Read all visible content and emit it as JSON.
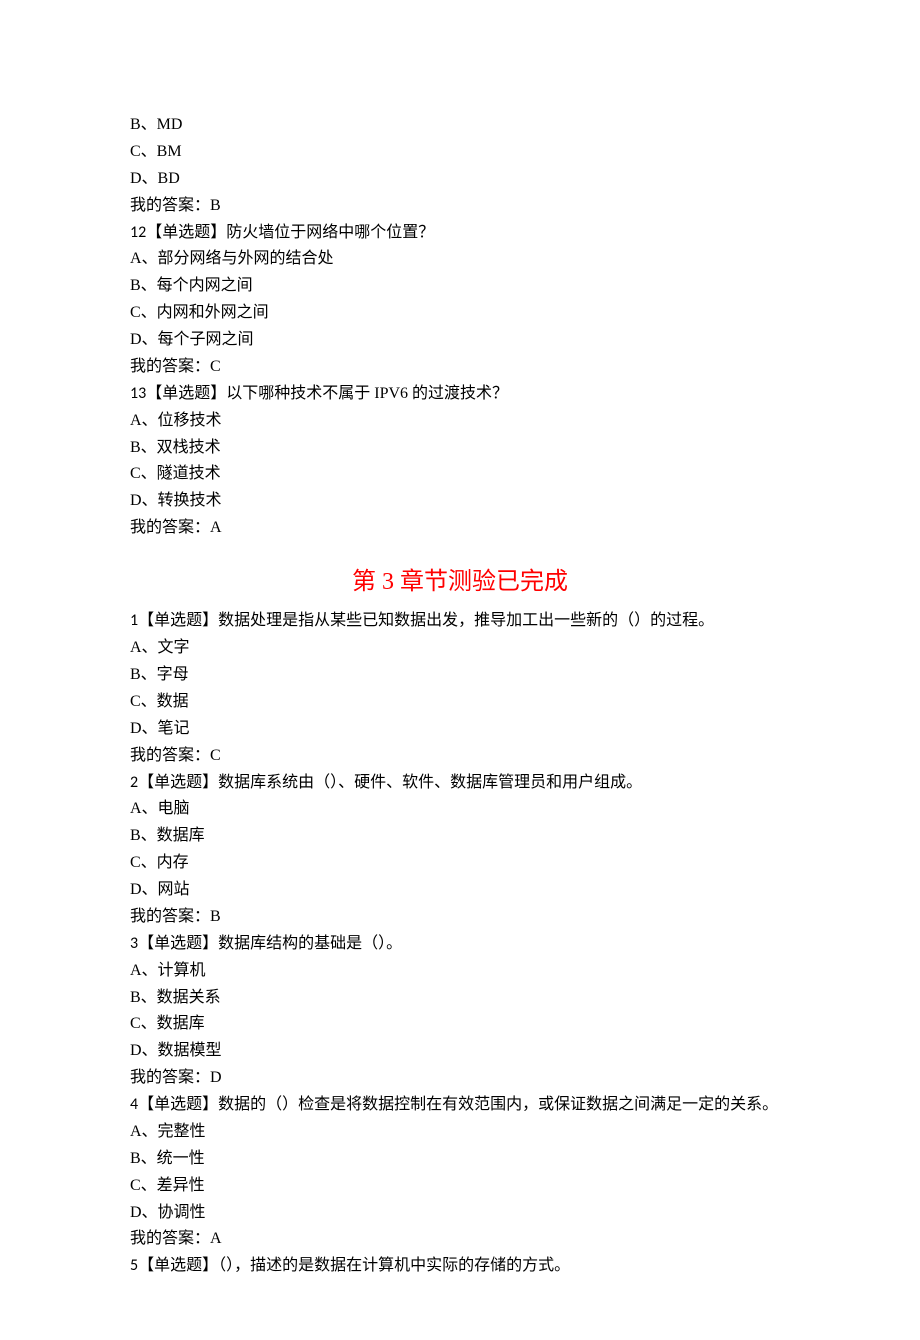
{
  "colors": {
    "heading": "#ff0000",
    "body": "#000000"
  },
  "truncatedOptions": [
    "B、MD",
    "C、BM",
    "D、BD",
    "我的答案：B"
  ],
  "questions_top": [
    {
      "num": "12",
      "tag": "【单选题】",
      "stem": "防火墙位于网络中哪个位置？",
      "options": [
        "A、部分网络与外网的结合处",
        "B、每个内网之间",
        "C、内网和外网之间",
        "D、每个子网之间"
      ],
      "answer": "我的答案：C"
    },
    {
      "num": "13",
      "tag": "【单选题】",
      "stem": "以下哪种技术不属于 IPV6 的过渡技术？",
      "options": [
        "A、位移技术",
        "B、双栈技术",
        "C、隧道技术",
        "D、转换技术"
      ],
      "answer": "我的答案：A"
    }
  ],
  "heading": "第 3 章节测验已完成",
  "questions_bottom": [
    {
      "num": "1",
      "tag": "【单选题】",
      "stem": "数据处理是指从某些已知数据出发，推导加工出一些新的（）的过程。",
      "options": [
        "A、文字",
        "B、字母",
        "C、数据",
        "D、笔记"
      ],
      "answer": "我的答案：C"
    },
    {
      "num": "2",
      "tag": "【单选题】",
      "stem": "数据库系统由（）、硬件、软件、数据库管理员和用户组成。",
      "options": [
        "A、电脑",
        "B、数据库",
        "C、内存",
        "D、网站"
      ],
      "answer": "我的答案：B"
    },
    {
      "num": "3",
      "tag": "【单选题】",
      "stem": "数据库结构的基础是（）。",
      "options": [
        "A、计算机",
        "B、数据关系",
        "C、数据库",
        "D、数据模型"
      ],
      "answer": "我的答案：D"
    },
    {
      "num": "4",
      "tag": "【单选题】",
      "stem": "数据的（）检查是将数据控制在有效范围内，或保证数据之间满足一定的关系。",
      "options": [
        "A、完整性",
        "B、统一性",
        "C、差异性",
        "D、协调性"
      ],
      "answer": "我的答案：A"
    },
    {
      "num": "5",
      "tag": "【单选题】",
      "stem": "（），描述的是数据在计算机中实际的存储的方式。",
      "options": [],
      "answer": ""
    }
  ]
}
